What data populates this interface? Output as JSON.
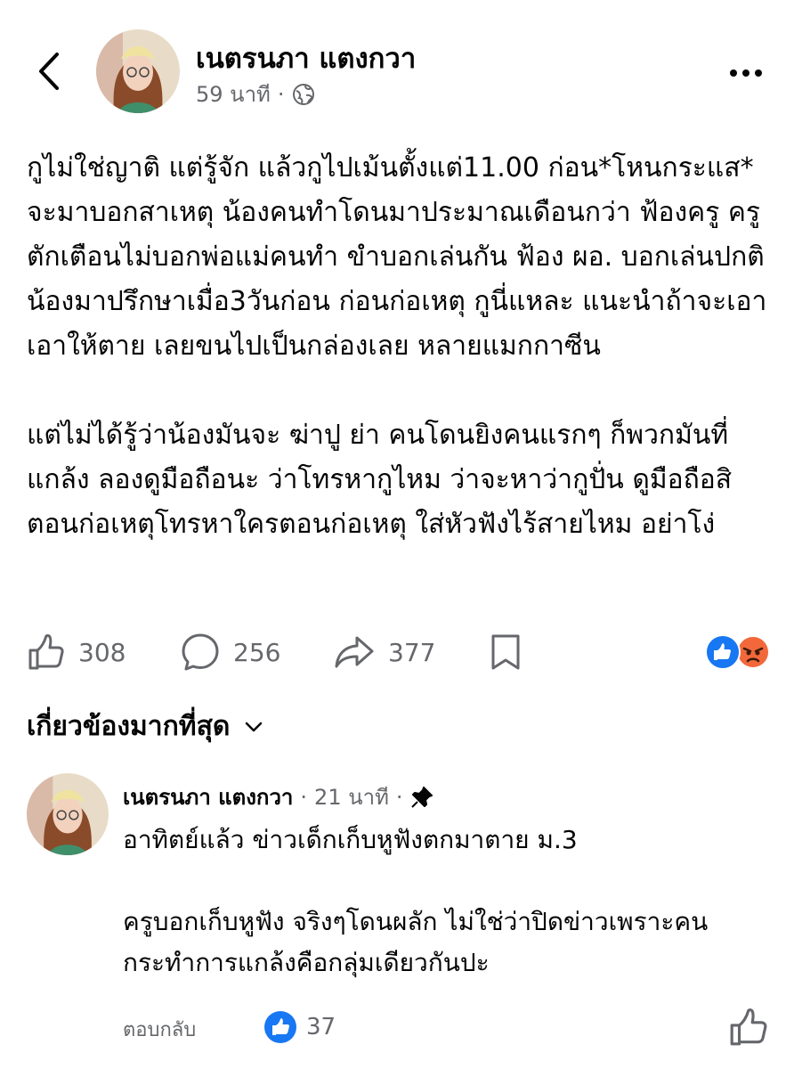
{
  "post": {
    "author": "เนตรนภา แตงกวา",
    "time": "59 นาที",
    "separator": "·",
    "body": [
      "กูไม่ใช่ญาติ แต่รู้จัก แล้วกูไปเม้นตั้งแต่11.00 ก่อน*โหนกระแส* จะมาบอกสาเหตุ น้องคนทำโดนมาประมาณเดือนกว่า ฟ้องครู ครูตักเตือนไม่บอกพ่อแม่คนทำ ขำบอกเล่นกัน ฟ้อง ผอ. บอกเล่นปกติ น้องมาปรึกษาเมื่อ3วันก่อน ก่อนก่อเหตุ กูนี่แหละ แนะนำถ้าจะเอา เอาให้ตาย เลยขนไปเป็นกล่องเลย หลายแมกกาซีน",
      "แต่ไม่ได้รู้ว่าน้องมันจะ ฆ่าปู ย่า คนโดนยิงคนแรกๆ ก็พวกมันที่แกล้ง ลองดูมือถือนะ ว่าโทรหากูไหม ว่าจะหาว่ากูปั่น ดูมือถือสิตอนก่อเหตุโทรหาใครตอนก่อเหตุ ใส่หัวฟังไร้สายไหม อย่าโง่"
    ],
    "likes": "308",
    "comments": "256",
    "shares": "377"
  },
  "filter": {
    "label": "เกี่ยวข้องมากที่สุด"
  },
  "comment": {
    "author": "เนตรนภา แตงกวา",
    "time": "21 นาที",
    "separator": "·",
    "body": [
      "อาทิตย์แล้ว ข่าวเด็กเก็บหูฟังตกมาตาย ม.3",
      "ครูบอกเก็บหูฟัง จริงๆโดนผลัก ไม่ใช่ว่าปิดข่าวเพราะคนกระทำการแกล้งคือกลุ่มเดียวกันปะ"
    ],
    "reply_label": "ตอบกลับ",
    "likes": "37"
  },
  "colors": {
    "secondary_text": "#65676b",
    "like_blue": "#1877f2",
    "angry_orange": "#f2683a"
  },
  "icons": [
    "back-arrow-icon",
    "globe-icon",
    "more-icon",
    "like-icon",
    "comment-icon",
    "share-icon",
    "bookmark-icon",
    "like-reaction-icon",
    "angry-reaction-icon",
    "chevron-down-icon",
    "pin-icon"
  ]
}
